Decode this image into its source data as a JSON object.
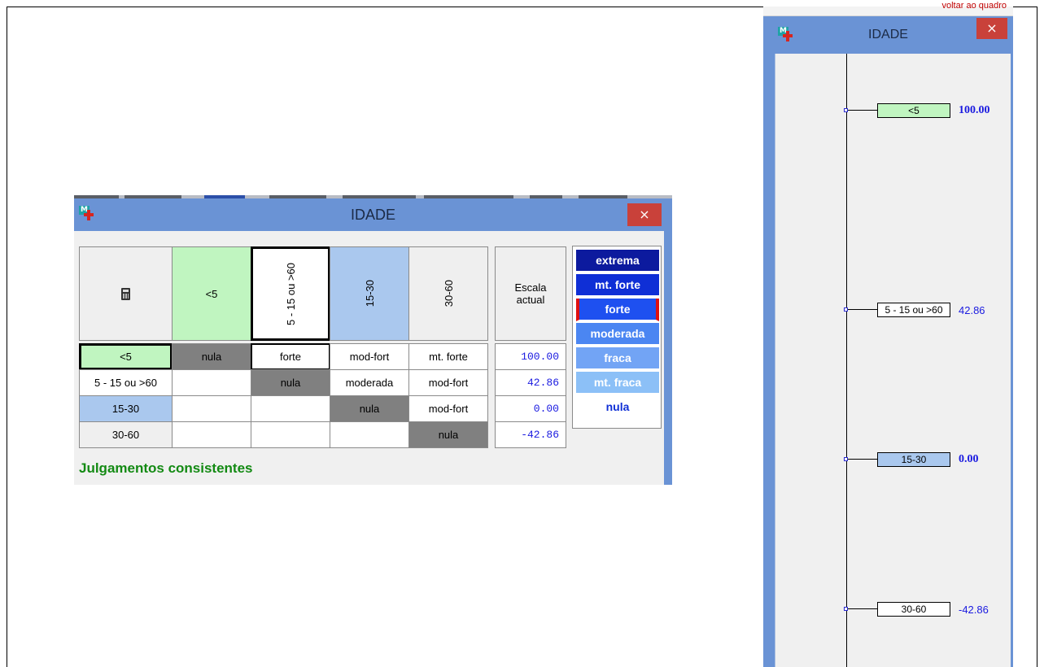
{
  "matrix_window": {
    "title": "IDADE",
    "close_label": "×",
    "header_calc_icon": "calculator-icon",
    "col_headers": [
      "<5",
      "5 - 15 ou >60",
      "15-30",
      "30-60"
    ],
    "scale_header": "Escala actual",
    "rows": [
      {
        "label": "<5",
        "cells": [
          "nula",
          "forte",
          "mod-fort",
          "mt. forte"
        ],
        "value": "100.00"
      },
      {
        "label": "5 - 15 ou >60",
        "cells": [
          "",
          "nula",
          "moderada",
          "mod-fort"
        ],
        "value": "42.86"
      },
      {
        "label": "15-30",
        "cells": [
          "",
          "",
          "nula",
          "mod-fort"
        ],
        "value": "0.00"
      },
      {
        "label": "30-60",
        "cells": [
          "",
          "",
          "",
          "nula"
        ],
        "value": "-42.86"
      }
    ],
    "legend": [
      "extrema",
      "mt. forte",
      "forte",
      "moderada",
      "fraca",
      "mt. fraca",
      "nula"
    ],
    "legend_selected": "forte",
    "status": "Julgamentos consistentes",
    "colors": {
      "green": "#c0f5c0",
      "light_blue": "#aac8ee",
      "diag_gray": "#808080",
      "titlebar": "#6a93d5",
      "status": "#138a13"
    }
  },
  "scale_window": {
    "top_link": "voltar ao quadro",
    "title": "IDADE",
    "close_label": "×",
    "points": [
      {
        "label": "<5",
        "value": "100.00",
        "bold": true
      },
      {
        "label": "5 - 15 ou >60",
        "value": "42.86",
        "bold": false
      },
      {
        "label": "15-30",
        "value": "0.00",
        "bold": true
      },
      {
        "label": "30-60",
        "value": "-42.86",
        "bold": false
      }
    ]
  }
}
